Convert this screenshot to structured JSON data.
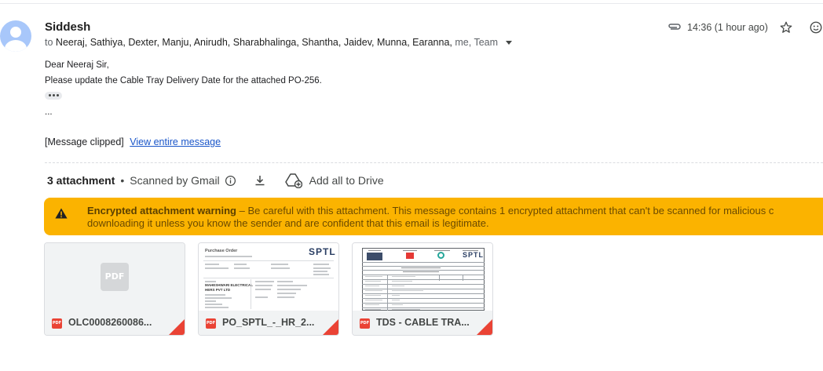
{
  "email": {
    "sender": "Siddesh",
    "to_label": "to",
    "recipients": "Neeraj, Sathiya, Dexter, Manju, Anirudh, Sharabhalinga, Shantha, Jaidev, Munna, Earanna,",
    "recipients_tail": "me, Team",
    "timestamp": "14:36 (1 hour ago)"
  },
  "body": {
    "greeting": "Dear Neeraj Sir,",
    "line1": "Please update the Cable Tray Delivery Date for the attached PO-256.",
    "dots": "...",
    "clipped_label": "[Message clipped]",
    "view_link": "View entire message"
  },
  "attachments": {
    "count_label": "3 attachment",
    "separator": "•",
    "scanned_label": "Scanned by Gmail",
    "add_drive_label": "Add all to Drive",
    "warning_title": "Encrypted attachment warning",
    "warning_dash": " – ",
    "warning_text": "Be careful with this attachment. This message contains 1 encrypted attachment that can't be scanned for malicious c",
    "warning_text2": "downloading it unless you know the sender and are confident that this email is legitimate.",
    "files": [
      {
        "name": "OLC0008260086...",
        "type_badge": "PDF",
        "placeholder": "PDF"
      },
      {
        "name": "PO_SPTL_-_HR_2...",
        "type_badge": "PDF"
      },
      {
        "name": "TDS - CABLE TRA...",
        "type_badge": "PDF"
      }
    ]
  },
  "preview": {
    "po_title": "Purchase Order",
    "po_logo": "SPTL",
    "po_supplier": "MAHESHWARI ELECTRICAL",
    "po_supplier2": "HERS PVT LTD",
    "tds_logo": "SPTL",
    "tds_pdf": "PDF"
  },
  "colors": {
    "warning_bg": "#fbb300",
    "pdf_red": "#ea4335",
    "link": "#1a56c9"
  },
  "icons": [
    "avatar-icon",
    "paperclip-icon",
    "star-icon",
    "emoji-icon",
    "info-icon",
    "download-icon",
    "drive-add-icon",
    "warning-icon",
    "pdf-icon"
  ]
}
